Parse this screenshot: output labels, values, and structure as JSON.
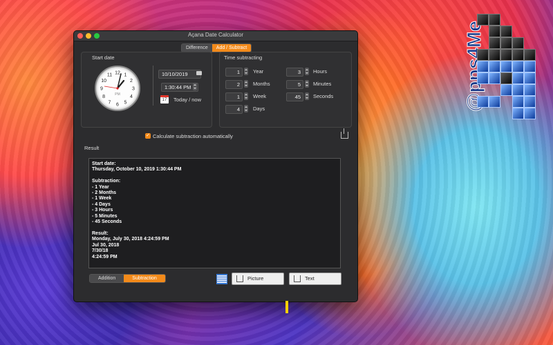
{
  "window": {
    "title": "Açana Date Calculator"
  },
  "top_tabs": [
    "Difference",
    "Add / Subtract"
  ],
  "start_date": {
    "section_label": "Start date",
    "date_value": "10/10/2019",
    "time_value": "1:30:44 PM",
    "today_label": "Today / now",
    "calendar_day": "17"
  },
  "time_subtracting": {
    "section_label": "Time subtracting",
    "left": [
      {
        "value": "1",
        "unit": "Year"
      },
      {
        "value": "2",
        "unit": "Months"
      },
      {
        "value": "1",
        "unit": "Week"
      },
      {
        "value": "4",
        "unit": "Days"
      }
    ],
    "right": [
      {
        "value": "3",
        "unit": "Hours"
      },
      {
        "value": "5",
        "unit": "Minutes"
      },
      {
        "value": "45",
        "unit": "Seconds"
      }
    ]
  },
  "auto_calc_label": "Calculate subtraction automatically",
  "result": {
    "label": "Result",
    "text": "Start date:\nThursday, October 10, 2019 1:30:44 PM\n\nSubtraction:\n- 1 Year\n- 2 Months\n- 1 Week\n- 4 Days\n- 3 Hours\n- 5 Minutes\n- 45 Seconds\n\nResult:\nMonday, July 30, 2018 4:24:59 PM\nJul 30, 2018\n7/30/18\n4:24:59 PM"
  },
  "bottom_tabs": [
    "Addition",
    "Subtraction"
  ],
  "export_buttons": {
    "picture": "Picture",
    "text": "Text"
  },
  "logo_text": "@pps4Me",
  "clock_numbers": [
    "12",
    "1",
    "2",
    "3",
    "4",
    "5",
    "6",
    "7",
    "8",
    "9",
    "10",
    "11"
  ],
  "clock_label": "PM",
  "colors": {
    "accent": "#f38a1a",
    "window": "#2c2c2e"
  }
}
